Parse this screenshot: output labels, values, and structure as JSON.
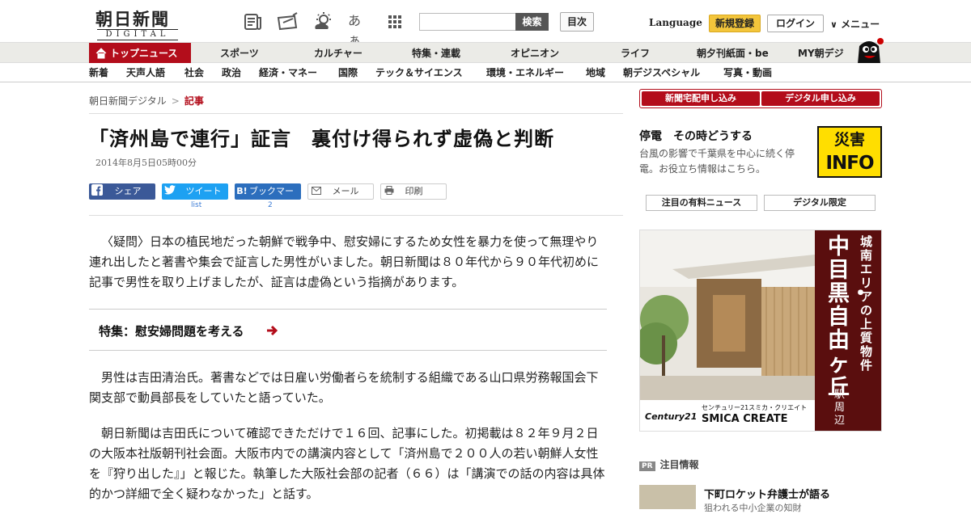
{
  "header": {
    "logo_main": "朝日新聞",
    "logo_sub": "DIGITAL",
    "search_placeholder": "",
    "search_button": "検索",
    "index_button": "目次",
    "language": "Language",
    "register": "新規登録",
    "login": "ログイン",
    "menu": "メニュー",
    "icons": [
      "newspaper-icon",
      "share-ticket-icon",
      "weather-icon",
      "font-size-icon",
      "grid-menu-icon"
    ],
    "font_size_label": "あぁ"
  },
  "nav_primary": {
    "top": "トップニュース",
    "items": [
      "スポーツ",
      "カルチャー",
      "特集・連載",
      "オピニオン",
      "ライフ",
      "朝夕刊紙面・be",
      "MY朝デジ"
    ]
  },
  "nav_secondary": {
    "items": [
      "新着",
      "天声人語",
      "社会",
      "政治",
      "経済・マネー",
      "国際",
      "テック＆サイエンス",
      "環境・エネルギー",
      "地域",
      "朝デジスペシャル",
      "写真・動画"
    ]
  },
  "breadcrumb": {
    "home": "朝日新聞デジタル",
    "sep": ">",
    "current": "記事"
  },
  "article": {
    "title": "「済州島で連行」証言　裏付け得られず虚偽と判断",
    "date": "2014年8月5日05時00分",
    "share": {
      "facebook": "シェア",
      "twitter": "ツイート",
      "twitter_sub": "list",
      "hatena_icon": "B!",
      "hatena": "ブックマーク",
      "hatena_sub": "2",
      "mail": "メール",
      "print": "印刷"
    },
    "lead": "〈疑問〉日本の植民地だった朝鮮で戦争中、慰安婦にするため女性を暴力を使って無理やり連れ出したと著書や集会で証言した男性がいました。朝日新聞は８０年代から９０年代初めに記事で男性を取り上げましたが、証言は虚偽という指摘があります。",
    "feature_link": "特集：慰安婦問題を考える",
    "para1": "男性は吉田清治氏。著書などでは日雇い労働者らを統制する組織である山口県労務報国会下関支部で動員部長をしていたと語っていた。",
    "para2": "朝日新聞は吉田氏について確認できただけで１６回、記事にした。初掲載は８２年９月２日の大阪本社版朝刊社会面。大阪市内での講演内容として「済州島で２００人の若い朝鮮人女性を『狩り出した』」と報じた。執筆した大阪社会部の記者（６６）は「講演での話の内容は具体的かつ詳細で全く疑わなかった」と話す。"
  },
  "sidebar": {
    "btn_delivery": "新聞宅配申し込み",
    "btn_digital": "デジタル申し込み",
    "teiden_title": "停電　その時どうする",
    "teiden_sub": "台風の影響で千葉県を中心に続く停電。お役立ち情報はこちら。",
    "info_top": "災害",
    "info_bottom": "INFO",
    "tab_paid": "注目の有料ニュース",
    "tab_digital": "デジタル限定",
    "ad": {
      "vertical_small": "城南エリアの上質物件",
      "vertical_big": "中目黒・自由ヶ丘",
      "vertical_tail": "駅周辺",
      "brand_jp": "センチュリー21スミカ・クリエイト",
      "brand_en": "SMICA CREATE",
      "brand_logo": "Century21"
    },
    "pr_badge": "PR",
    "pr_label": "注目情報",
    "pr_title": "下町ロケット弁護士が語る",
    "pr_sub": "狙われる中小企業の知財"
  },
  "colors": {
    "brand_red": "#b30d1b",
    "register_yellow": "#f3c53b",
    "info_yellow": "#ffde00",
    "facebook": "#3b5998",
    "twitter": "#1da1f2",
    "hatena": "#2c6ebd"
  }
}
